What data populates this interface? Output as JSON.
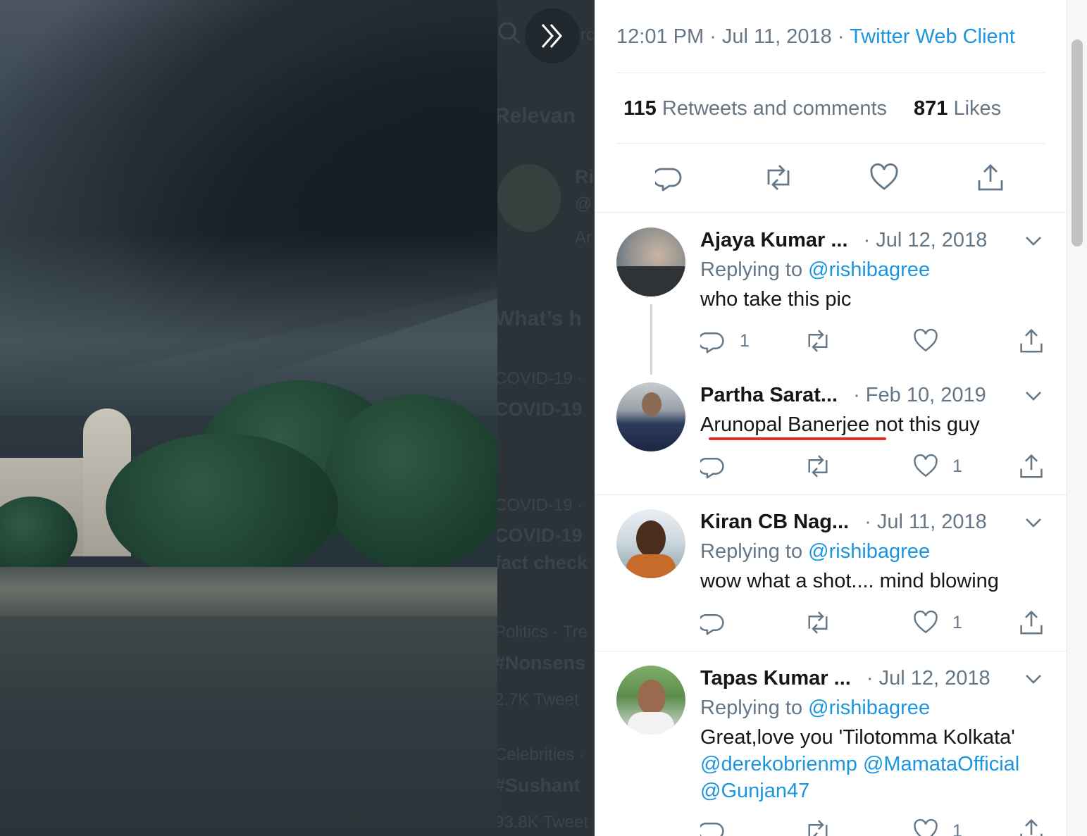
{
  "tweet": {
    "time": "12:01 PM",
    "date": "Jul 11, 2018",
    "client": "Twitter Web Client",
    "retweets_count": "115",
    "retweets_label": "Retweets and comments",
    "likes_count": "871",
    "likes_label": "Likes"
  },
  "background": {
    "search_partial": "rc",
    "relevant": "Relevan",
    "name_partial": "Ri",
    "handle_partial": "@",
    "text_partial": "Ar",
    "whats": "What’s h",
    "trends": [
      {
        "category": "COVID-19 ·",
        "title": "COVID-19"
      },
      {
        "category": "COVID-19 ·",
        "title": "COVID-19",
        "sub": "fact check"
      },
      {
        "category": "Politics · Tre",
        "title": "#Nonsens",
        "count": "2.7K Tweet"
      },
      {
        "category": "Celebrities ·",
        "title": "#Sushant",
        "count": "93.8K Tweet"
      }
    ]
  },
  "replies": [
    {
      "name": "Ajaya Kumar ...",
      "date": "· Jul 12, 2018",
      "replying_prefix": "Replying to",
      "replying_to": "@rishibagree",
      "text": "who take this pic",
      "reply_count": "1",
      "like_count": ""
    },
    {
      "name": "Partha Sarat...",
      "date": "· Feb 10, 2019",
      "text_underlined": "Arunopal Banerjee",
      "text_rest": " not this guy",
      "reply_count": "",
      "like_count": "1"
    },
    {
      "name": "Kiran CB Nag...",
      "date": "· Jul 11, 2018",
      "replying_prefix": "Replying to",
      "replying_to": "@rishibagree",
      "text": "wow what a shot.... mind blowing",
      "reply_count": "",
      "like_count": "1"
    },
    {
      "name": "Tapas Kumar ...",
      "date": "· Jul 12, 2018",
      "replying_prefix": "Replying to",
      "replying_to": "@rishibagree",
      "text": "Great,love you 'Tilotomma Kolkata'",
      "mentions_line1_a": "@derekobrienmp",
      "mentions_line1_b": "@MamataOfficial",
      "mentions_line2": "@Gunjan47",
      "reply_count": "",
      "like_count": "1"
    }
  ],
  "colors": {
    "link": "#1b95e0",
    "secondary_text": "#657786",
    "primary_text": "#14171a",
    "underline": "#e0301e"
  },
  "icons": [
    "search-icon",
    "double-chevron-right-icon",
    "reply-icon",
    "retweet-icon",
    "like-icon",
    "share-icon",
    "chevron-down-icon"
  ]
}
